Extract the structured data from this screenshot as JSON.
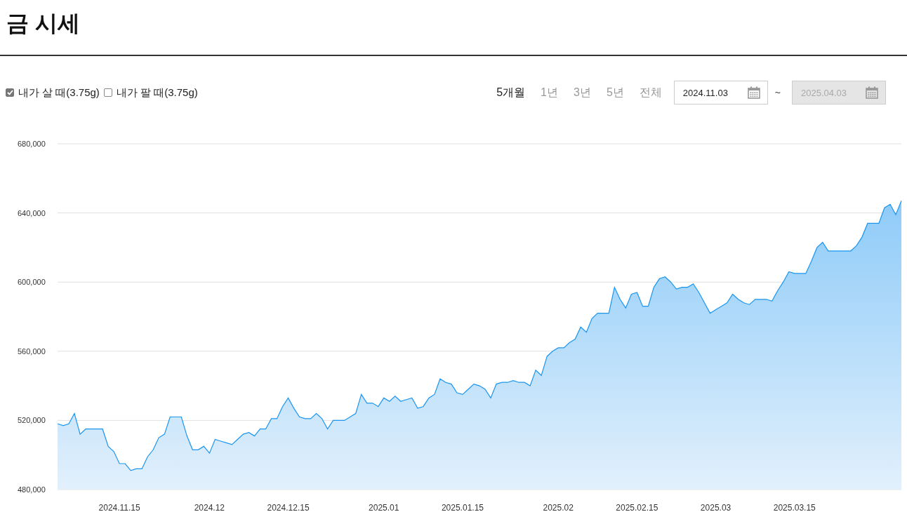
{
  "title": "금 시세",
  "options": [
    {
      "label": "내가 살 때(3.75g)",
      "checked": true
    },
    {
      "label": "내가 팔 때(3.75g)",
      "checked": false
    }
  ],
  "periods": [
    {
      "label": "5개월",
      "selected": true
    },
    {
      "label": "1년",
      "selected": false
    },
    {
      "label": "3년",
      "selected": false
    },
    {
      "label": "5년",
      "selected": false
    },
    {
      "label": "전체",
      "selected": false
    }
  ],
  "date_range": {
    "start": {
      "value": "2024.11.03",
      "disabled": false
    },
    "separator": "~",
    "end": {
      "value": "2025.04.03",
      "disabled": true
    }
  },
  "chart_data": {
    "type": "area",
    "grid": true,
    "ylim": [
      480000,
      680000
    ],
    "yticks": [
      {
        "value": 480000,
        "label": "480,000"
      },
      {
        "value": 520000,
        "label": "520,000"
      },
      {
        "value": 560000,
        "label": "560,000"
      },
      {
        "value": 600000,
        "label": "600,000"
      },
      {
        "value": 640000,
        "label": "640,000"
      },
      {
        "value": 680000,
        "label": "680,000"
      }
    ],
    "categories": [
      null,
      null,
      null,
      null,
      null,
      null,
      null,
      null,
      null,
      null,
      null,
      "2024.11.15",
      null,
      null,
      null,
      null,
      null,
      null,
      null,
      null,
      null,
      null,
      null,
      null,
      null,
      null,
      null,
      "2024.12",
      null,
      null,
      null,
      null,
      null,
      null,
      null,
      null,
      null,
      null,
      null,
      null,
      null,
      "2024.12.15",
      null,
      null,
      null,
      null,
      null,
      null,
      null,
      null,
      null,
      null,
      null,
      null,
      null,
      null,
      null,
      null,
      "2025.01",
      null,
      null,
      null,
      null,
      null,
      null,
      null,
      null,
      null,
      null,
      null,
      null,
      null,
      "2025.01.15",
      null,
      null,
      null,
      null,
      null,
      null,
      null,
      null,
      null,
      null,
      null,
      null,
      null,
      null,
      null,
      null,
      "2025.02",
      null,
      null,
      null,
      null,
      null,
      null,
      null,
      null,
      null,
      null,
      null,
      null,
      null,
      "2025.02.15",
      null,
      null,
      null,
      null,
      null,
      null,
      null,
      null,
      null,
      null,
      null,
      null,
      null,
      "2025.03",
      null,
      null,
      null,
      null,
      null,
      null,
      null,
      null,
      null,
      null,
      null,
      null,
      null,
      "2025.03.15",
      null,
      null,
      null,
      null,
      null,
      null,
      null,
      null,
      null,
      null,
      null,
      null,
      null,
      null,
      null,
      null,
      null,
      null,
      null
    ],
    "series": [
      {
        "color": "#1a95f0",
        "values": [
          518000,
          517000,
          518000,
          524000,
          512000,
          515000,
          515000,
          515000,
          515000,
          505000,
          502000,
          495000,
          495000,
          491000,
          492000,
          492000,
          499000,
          503000,
          510000,
          512000,
          522000,
          522000,
          522000,
          511000,
          503000,
          503000,
          505000,
          501000,
          509000,
          508000,
          507000,
          506000,
          509000,
          512000,
          513000,
          511000,
          515000,
          515000,
          521000,
          521000,
          528000,
          533000,
          527000,
          522000,
          521000,
          521000,
          524000,
          521000,
          515000,
          520000,
          520000,
          520000,
          522000,
          524000,
          535000,
          530000,
          530000,
          528000,
          533000,
          531000,
          534000,
          531000,
          532000,
          533000,
          527000,
          528000,
          533000,
          535000,
          544000,
          542000,
          541000,
          536000,
          535000,
          538000,
          541000,
          540000,
          538000,
          533000,
          541000,
          542000,
          542000,
          543000,
          542000,
          542000,
          540000,
          549000,
          546000,
          557000,
          560000,
          562000,
          562000,
          565000,
          567000,
          574000,
          571000,
          579000,
          582000,
          582000,
          582000,
          597000,
          590000,
          585000,
          593000,
          594000,
          586000,
          586000,
          597000,
          602000,
          603000,
          600000,
          596000,
          597000,
          597000,
          599000,
          594000,
          588000,
          582000,
          584000,
          586000,
          588000,
          593000,
          590000,
          588000,
          587000,
          590000,
          590000,
          590000,
          589000,
          595000,
          600000,
          606000,
          605000,
          605000,
          605000,
          612000,
          620000,
          623000,
          618000,
          618000,
          618000,
          618000,
          618000,
          621000,
          626000,
          634000,
          634000,
          634000,
          643000,
          645000,
          639000,
          647000
        ]
      }
    ]
  }
}
